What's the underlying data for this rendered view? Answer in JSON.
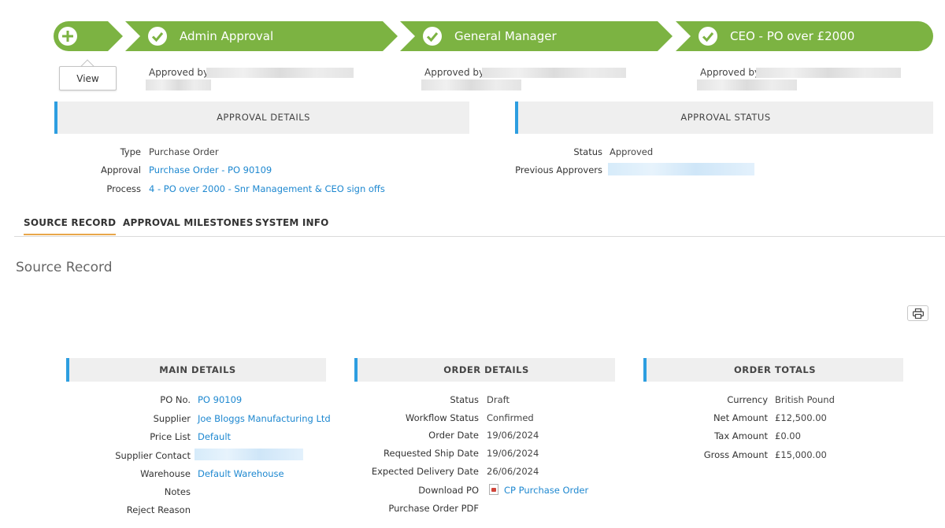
{
  "path": {
    "steps": [
      {
        "label": "Admin Approval"
      },
      {
        "label": "General Manager"
      },
      {
        "label": "CEO - PO over £2000"
      }
    ],
    "view_label": "View",
    "approved_by": [
      "Approved by",
      "Approved by",
      "Approved by"
    ]
  },
  "approval_details": {
    "header": "APPROVAL DETAILS",
    "fields": [
      {
        "label": "Type",
        "value": "Purchase Order"
      },
      {
        "label": "Approval",
        "value": "Purchase Order - PO 90109"
      },
      {
        "label": "Process",
        "value": "4 - PO over 2000 - Snr Management & CEO sign offs"
      }
    ]
  },
  "approval_status": {
    "header": "APPROVAL STATUS",
    "fields": [
      {
        "label": "Status",
        "value": "Approved"
      },
      {
        "label": "Previous Approvers",
        "value": ""
      }
    ]
  },
  "tabs": [
    "SOURCE RECORD",
    "APPROVAL MILESTONES",
    "SYSTEM INFO"
  ],
  "source_title": "Source Record",
  "main_details": {
    "header": "MAIN DETAILS",
    "fields": [
      {
        "label": "PO No.",
        "value": "PO 90109"
      },
      {
        "label": "Supplier",
        "value": "Joe Bloggs Manufacturing Ltd"
      },
      {
        "label": "Price List",
        "value": "Default"
      },
      {
        "label": "Supplier Contact",
        "value": ""
      },
      {
        "label": "Warehouse",
        "value": "Default Warehouse"
      },
      {
        "label": "Notes",
        "value": ""
      },
      {
        "label": "Reject Reason",
        "value": ""
      }
    ]
  },
  "order_details": {
    "header": "ORDER DETAILS",
    "fields": [
      {
        "label": "Status",
        "value": "Draft"
      },
      {
        "label": "Workflow Status",
        "value": "Confirmed"
      },
      {
        "label": "Order Date",
        "value": "19/06/2024"
      },
      {
        "label": "Requested Ship Date",
        "value": "19/06/2024"
      },
      {
        "label": "Expected Delivery Date",
        "value": "26/06/2024"
      },
      {
        "label": "Download PO",
        "value": "CP Purchase Order"
      },
      {
        "label": "Purchase Order PDF",
        "value": ""
      }
    ]
  },
  "order_totals": {
    "header": "ORDER TOTALS",
    "fields": [
      {
        "label": "Currency",
        "value": "British Pound"
      },
      {
        "label": "Net Amount",
        "value": "£12,500.00"
      },
      {
        "label": "Tax Amount",
        "value": "£0.00"
      },
      {
        "label": "Gross Amount",
        "value": "£15,000.00"
      }
    ]
  },
  "colors": {
    "path_green": "#7cb342",
    "accent_blue": "#2d9ee0",
    "link_blue": "#1e88d0",
    "tab_underline": "#e8a64a"
  }
}
